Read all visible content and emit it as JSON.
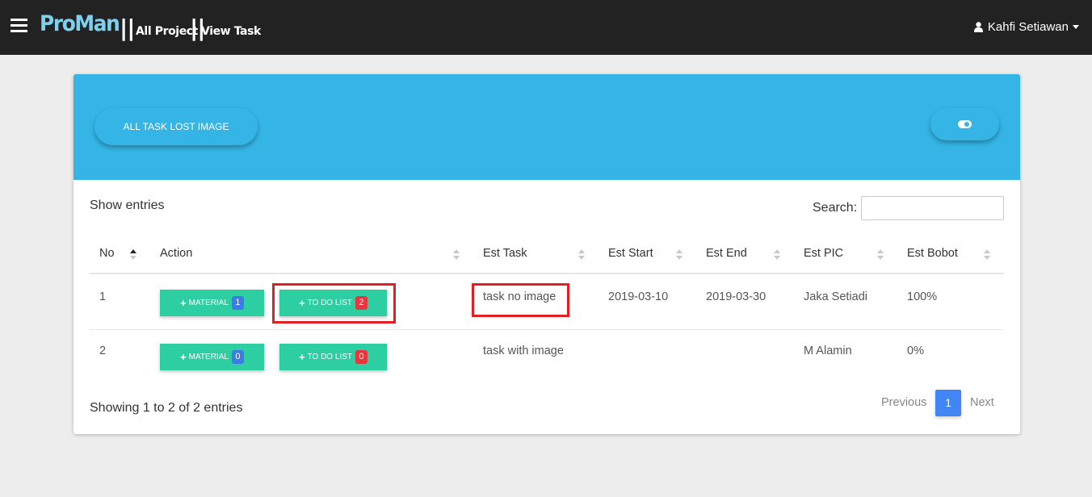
{
  "navbar": {
    "brand": "ProMan",
    "separator": "||",
    "crumb_project": "All Project",
    "crumb_task": "View Task",
    "user_name": "Kahfi Setiawan"
  },
  "card": {
    "lost_image_button": "ALL TASK LOST IMAGE",
    "toggle_icon": "toggle-on-icon"
  },
  "table": {
    "show_entries": "Show entries",
    "search_label": "Search:",
    "search_value": "",
    "columns": [
      "No",
      "Action",
      "Est Task",
      "Est Start",
      "Est End",
      "Est PIC",
      "Est Bobot"
    ],
    "rows": [
      {
        "no": "1",
        "material_label": "MATERIAL",
        "material_count": "1",
        "todo_label": "TO DO LIST",
        "todo_count": "2",
        "task": "task no image",
        "start": "2019-03-10",
        "end": "2019-03-30",
        "pic": "Jaka Setiadi",
        "bobot": "100%"
      },
      {
        "no": "2",
        "material_label": "MATERIAL",
        "material_count": "0",
        "todo_label": "TO DO LIST",
        "todo_count": "0",
        "task": "task with image",
        "start": "",
        "end": "",
        "pic": "M Alamin",
        "bobot": "0%"
      }
    ],
    "info": "Showing 1 to 2 of 2 entries",
    "pagination": {
      "previous": "Previous",
      "current": "1",
      "next": "Next"
    }
  },
  "colors": {
    "header_blue": "#34b5e6",
    "action_green": "#2dcfa2",
    "badge_blue": "#3f7be8",
    "badge_red": "#e8363f",
    "highlight_red": "#e31e24",
    "page_blue": "#4285f4",
    "navbar": "#222222"
  }
}
